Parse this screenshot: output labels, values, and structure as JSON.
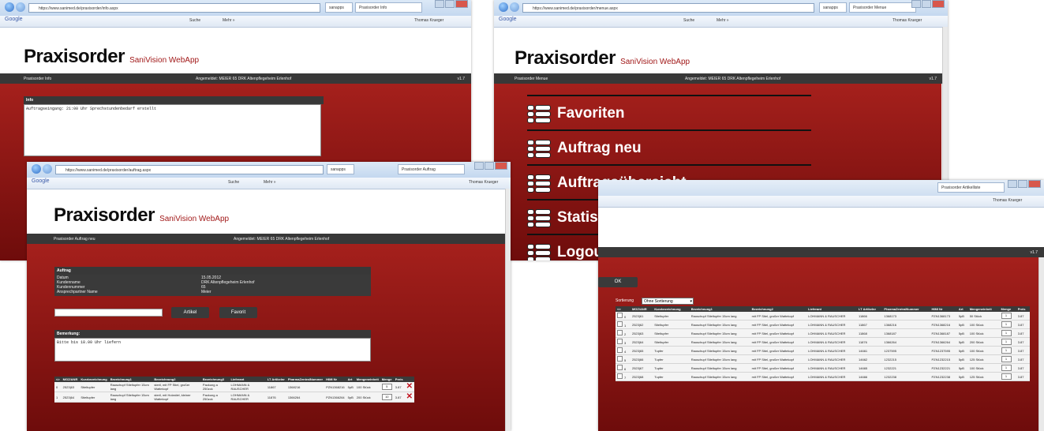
{
  "colors": {
    "brand_red": "#a11818",
    "bar_dark": "#383838",
    "danger": "#c1121e"
  },
  "app": {
    "name": "Praxisorder",
    "subtitle": "SaniVision WebApp",
    "version": "v1.7"
  },
  "browser": {
    "search_engine": "Google",
    "toolbar_search": "Suche",
    "toolbar_more": "Mehr »",
    "user": "Thomas Krueger",
    "url_info": "https://www.sanimed.de/praxisorder/info.aspx",
    "url_menu": "https://www.sanimed.de/praxisorder/menue.aspx",
    "url_auftrag": "https://www.sanimed.de/praxisorder/auftrag.aspx",
    "tab_info": "Praxisorder Info",
    "tab_menu": "Praxisorder Menue",
    "tab_auftrag": "Praxisorder Auftrag",
    "tab_artikel": "Praxisorder Artikelliste",
    "tab_extra": "sanapps"
  },
  "status": {
    "logged_in": "Angemeldet: MEIER 65 DRK Altenpflegeheim Erlenhof"
  },
  "info_page": {
    "bar_title": "Praxisorder Info",
    "panel_title": "Info",
    "message": "Auftragseingang: 21:00 Uhr Sprechstundenbedarf erstellt"
  },
  "menu_page": {
    "bar_title": "Praxisorder Menue",
    "items": [
      {
        "label": "Favoriten",
        "icon": "list-icon"
      },
      {
        "label": "Auftrag neu",
        "icon": "list-icon"
      },
      {
        "label": "Auftragsübersicht",
        "icon": "list-icon"
      },
      {
        "label": "Statistik",
        "icon": "list-icon"
      },
      {
        "label": "Logout",
        "icon": "list-icon"
      }
    ]
  },
  "auftrag_page": {
    "bar_title": "Praxisorder Auftrag neu",
    "section_title": "Auftrag",
    "fields": [
      {
        "label": "Datum",
        "value": "15.05.2012"
      },
      {
        "label": "Kundenname",
        "value": "DRK Altenpflegeheim Erlenhof"
      },
      {
        "label": "Kundennummer",
        "value": "65"
      },
      {
        "label": "Ansprechpartner Name",
        "value": "Meier"
      }
    ],
    "search_placeholder": "",
    "btn_artikel": "Artikel",
    "btn_favorit": "Favorit",
    "remark_title": "Bemerkung:",
    "remark_text": "Bitte bis 18.00 Uhr liefern",
    "columns": [
      "<>",
      "MGZ/ANR",
      "Kurzbezeichnung",
      "Bezeichnung1",
      "Bezeichnung2",
      "Bezeichnung3",
      "Lieferant",
      "LT Artikelnr",
      "PharmaZentralNummer",
      "HIMI Nr",
      "Art",
      "Mengeneinheit",
      "Menge",
      "Preis"
    ],
    "rows": [
      [
        "0",
        "2523|63",
        "Stieltupfer",
        "Rauschupf Stieltupfer 15cm lang",
        "steril, mit FP Stiel, großer Wattekopf",
        "Packung a 250zck",
        "LOHMANN & RAUSCHER",
        "11867",
        "1368216",
        "PZN1368216",
        "5pB",
        "100 Stück",
        "5",
        "3.87"
      ],
      [
        "1",
        "2523|64",
        "Stieltupfer",
        "Rauschupf Stieltupfer 15cm lang",
        "steril, mit Holzstiel, kleiner Wattekopf",
        "Packung a 250zck",
        "LOHMANN & RAUSCHER",
        "11876",
        "1366264",
        "PZN1366264",
        "5pB",
        "200 Stück",
        "10",
        "3.87"
      ]
    ]
  },
  "artikel_page": {
    "ok_label": "OK",
    "sort_label": "Sortierung",
    "sort_value": "Ohne Sortierung",
    "columns": [
      "<>",
      "MGZ/ANR",
      "Kurzbezeichnung",
      "Bezeichnung1",
      "Bezeichnung2",
      "Bezeichnung3",
      "Lieferant",
      "LT Artikelnr",
      "PharmaZentralNummer",
      "HIMI Nr",
      "Art",
      "Mengeneinheit",
      "Menge",
      "Preis"
    ],
    "rows": [
      [
        "0",
        "2523|61",
        "Stieltupfer",
        "Rauschupf Stieltupfer 15cm lang",
        "mit FP Stiel, großer Wattekopf",
        "",
        "LOHMANN & RAUSCHER",
        "11866",
        "1368173",
        "PZN1368173",
        "5pB",
        "50 Stück",
        "1",
        "3.87"
      ],
      [
        "1",
        "2523|62",
        "Stieltupfer",
        "Rauschupf Stieltupfer 15cm lang",
        "mit FP Stiel, großer Wattekopf",
        "Packung a 250zck",
        "LOHMANN & RAUSCHER",
        "11867",
        "1368216",
        "PZN1368216",
        "5pB",
        "100 Stück",
        "1",
        "3.87"
      ],
      [
        "2",
        "2523|63",
        "Stieltupfer",
        "Rauschupf Stieltupfer 15cm lang",
        "mit FP Stiel, großer Wattekopf",
        "",
        "LOHMANN & RAUSCHER",
        "11868",
        "1368187",
        "PZN1368187",
        "5pB",
        "100 Stück",
        "1",
        "3.87"
      ],
      [
        "3",
        "2523|64",
        "Stieltupfer",
        "Rauschupf Stieltupfer 15cm lang",
        "mit FP Stiel, großer Wattekopf",
        "Packung a 250zck",
        "LOHMANN & RAUSCHER",
        "11876",
        "1366264",
        "PZN1366264",
        "5pB",
        "200 Stück",
        "1",
        "3.87"
      ],
      [
        "4",
        "2523|65",
        "Tupfer",
        "Rauschupf Stieltupfer 15cm lang",
        "mit FP Stiel, großer Wattekopf",
        "Verbandmull DIN 61 630-VM 20",
        "LOHMANN & RAUSCHER",
        "14661",
        "1237595",
        "PZN1237595",
        "5pB",
        "100 Stück",
        "1",
        "3.87"
      ],
      [
        "5",
        "2523|66",
        "Tupfer",
        "Rauschupf Stieltupfer 15cm lang",
        "mit FP Stiel, großer Wattekopf",
        "Verbandmull DIN 61 630-VM 20",
        "LOHMANN & RAUSCHER",
        "14662",
        "1232215",
        "PZN1232215",
        "5pB",
        "125 Stück",
        "1",
        "3.87"
      ],
      [
        "6",
        "2523|67",
        "Tupfer",
        "Rauschupf Stieltupfer 15cm lang",
        "mit FP Stiel, großer Wattekopf",
        "Verbandmull DIN 61 630-VM 20",
        "LOHMANN & RAUSCHER",
        "14665",
        "1232221",
        "PZN1232221",
        "5pB",
        "100 Stück",
        "1",
        "3.87"
      ],
      [
        "7",
        "2523|68",
        "Tupfer",
        "Rauschupf Stieltupfer 15cm lang",
        "mit FP Stiel, großer Wattekopf",
        "Verbandmull DIN 61 630-VM 20",
        "LOHMANN & RAUSCHER",
        "14666",
        "1232238",
        "PZN1232238",
        "5pB",
        "125 Stück",
        "1",
        "3.87"
      ]
    ]
  }
}
